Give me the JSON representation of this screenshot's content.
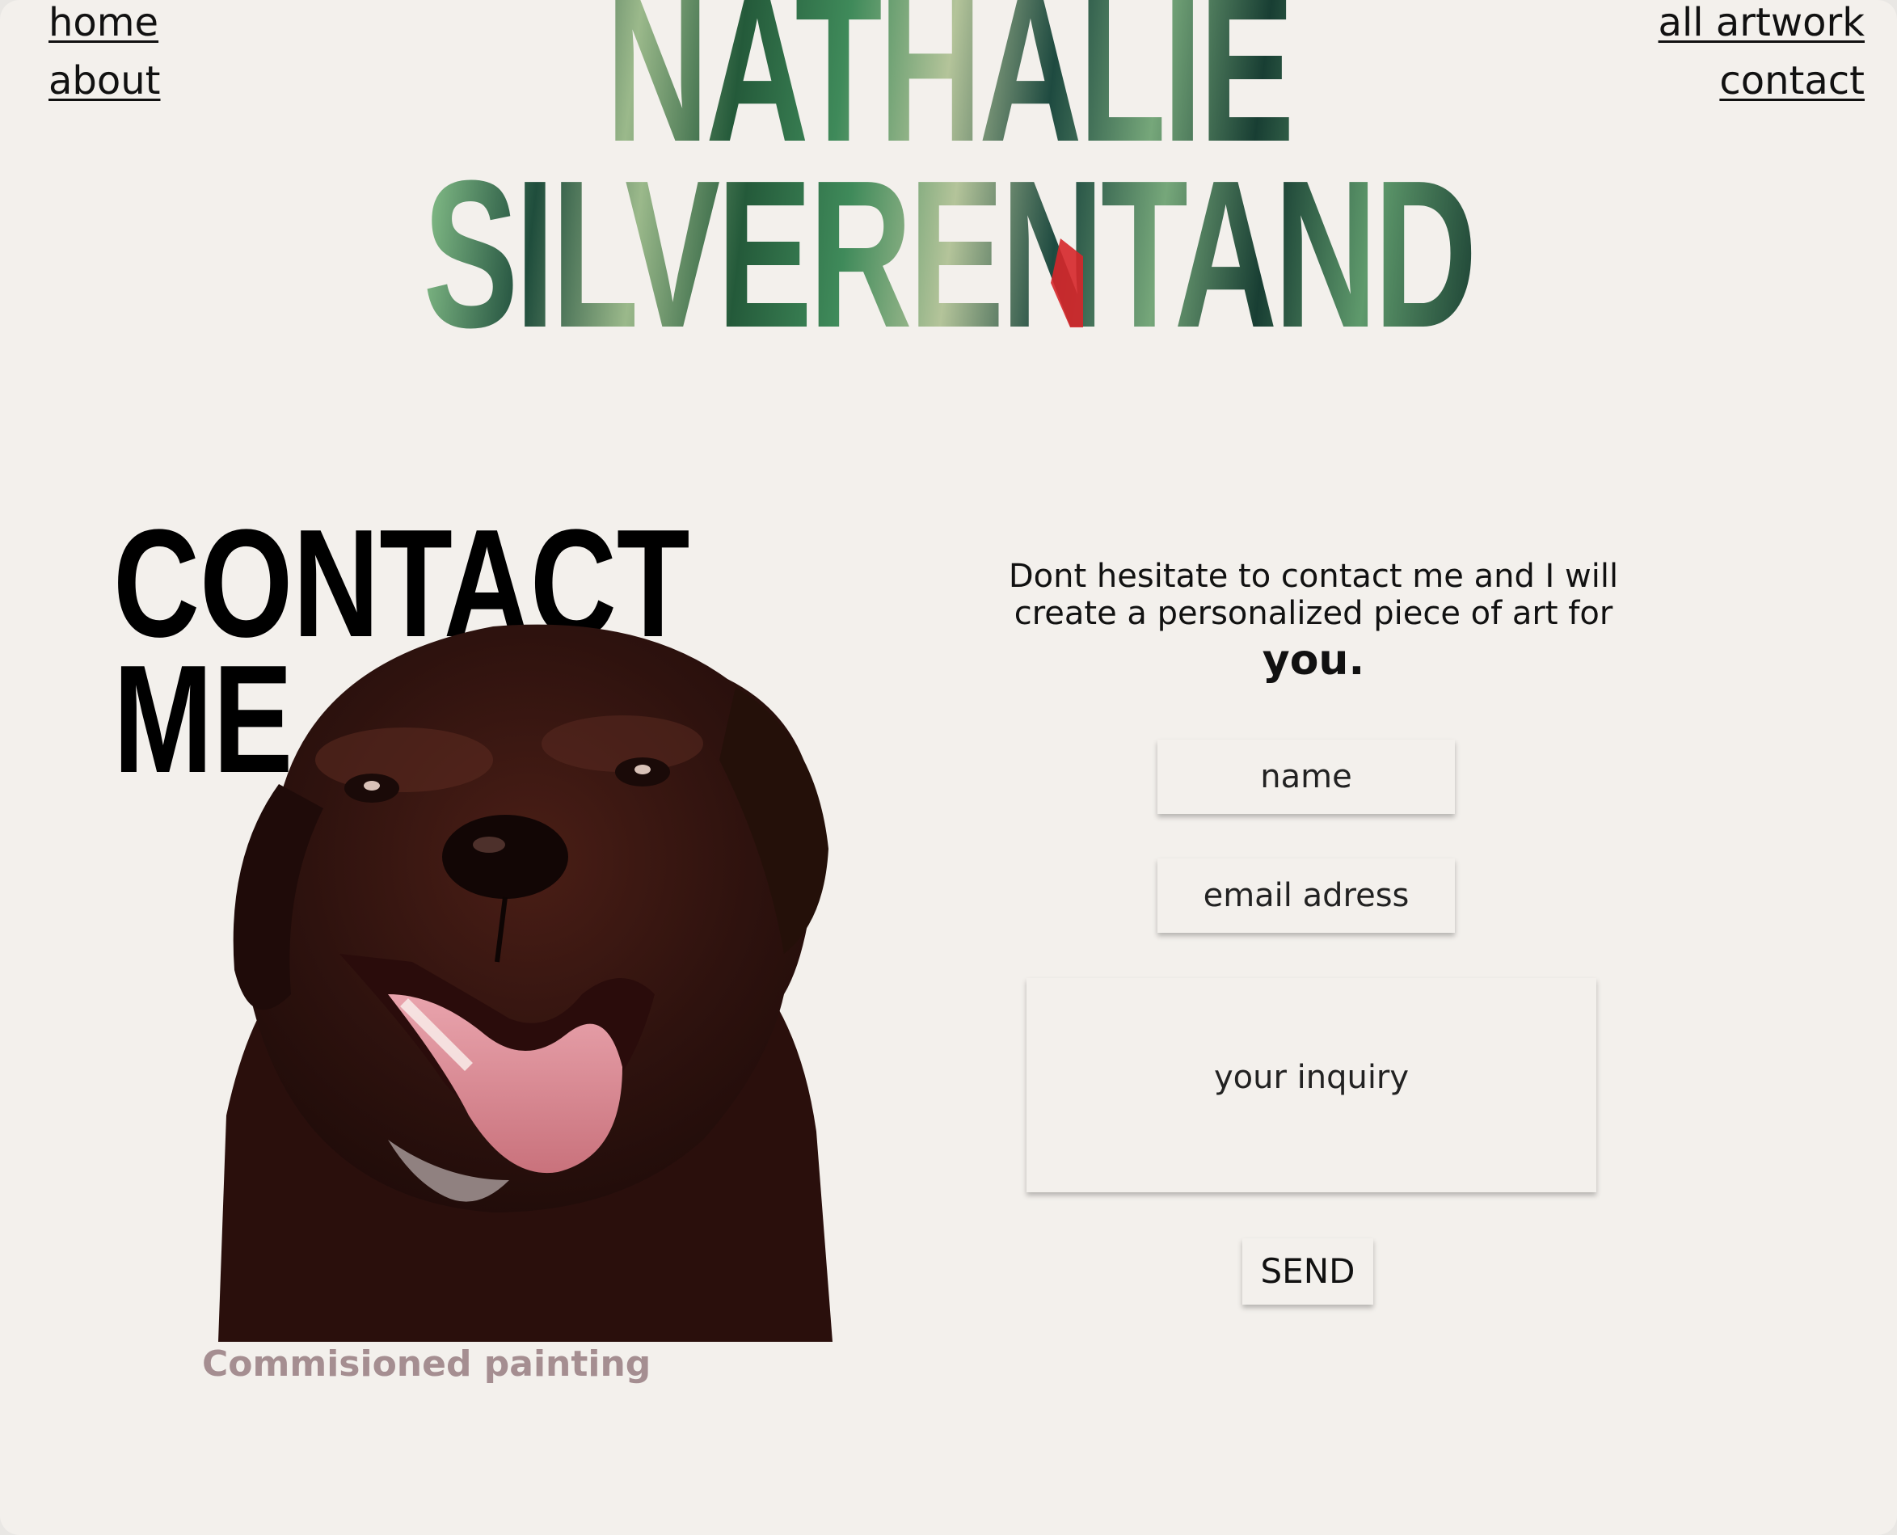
{
  "nav": {
    "home": "home",
    "about": "about",
    "all_artwork": "all artwork",
    "contact": "contact"
  },
  "site_title": {
    "line1": "NATHALIE",
    "line2": "SILVERENTAND"
  },
  "contact_heading": {
    "line1": "CONTACT",
    "line2": "ME"
  },
  "artwork": {
    "caption": "Commisioned painting",
    "icon": "dog-painting"
  },
  "intro": {
    "line1": "Dont hesitate to contact me and I will",
    "line2": "create a personalized piece of art for",
    "emphasis": "you."
  },
  "form": {
    "name_placeholder": "name",
    "email_placeholder": "email adress",
    "inquiry_placeholder": "your inquiry",
    "send_label": "SEND"
  },
  "colors": {
    "background": "#f3f0ec",
    "caption": "#a58e91",
    "accent_red": "#d6262a"
  }
}
